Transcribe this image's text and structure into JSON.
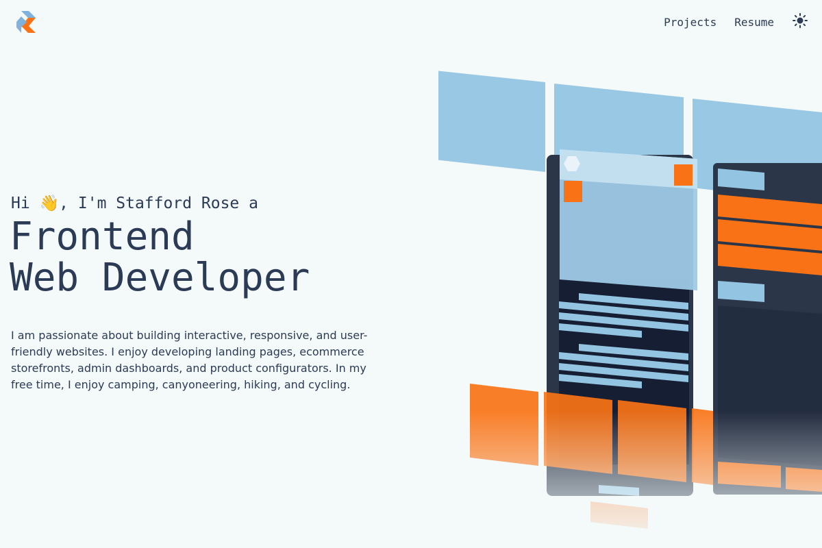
{
  "header": {
    "logo_icon": "sr-logo-icon",
    "nav": [
      {
        "label": "Projects"
      },
      {
        "label": "Resume"
      }
    ],
    "theme_icon": "sun-icon"
  },
  "hero": {
    "greeting": "Hi 👋, I'm Stafford Rose a",
    "title_line1": "Frontend",
    "title_line2": "Web Developer",
    "bio": "I am passionate about building interactive, responsive, and user-friendly websites. I enjoy developing landing pages, ecommerce storefronts, admin dashboards, and product configurators. In my free time, I enjoy camping, canyoneering, hiking, and cycling."
  },
  "colors": {
    "text": "#2b3a55",
    "background": "#f4f9fa",
    "accent_orange": "#f97316",
    "accent_blue": "#93c5e3",
    "dark_panel": "#2b3648"
  }
}
